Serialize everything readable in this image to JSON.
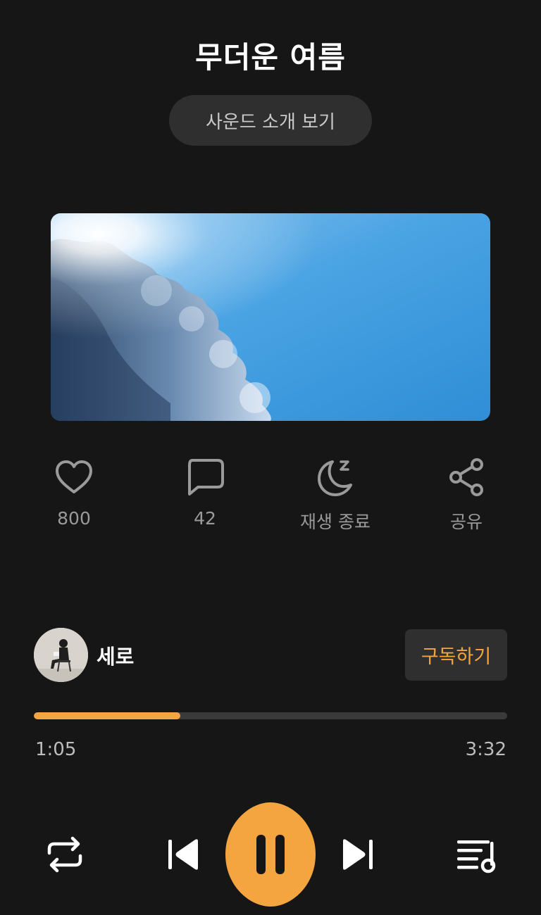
{
  "header": {
    "title": "무더운 여름",
    "intro_label": "사운드 소개 보기"
  },
  "actions": {
    "like_count": "800",
    "comment_count": "42",
    "sleep_timer_label": "재생 종료",
    "share_label": "공유"
  },
  "artist": {
    "name": "세로",
    "subscribe_label": "구독하기"
  },
  "player": {
    "current_time": "1:05",
    "total_time": "3:32",
    "progress": 0.309
  },
  "colors": {
    "accent": "#f5a540",
    "background": "#161616",
    "surface": "#2f2f2f"
  },
  "icons": {
    "like": "heart-icon",
    "comment": "speech-bubble-icon",
    "sleep": "moon-zzz-icon",
    "share": "share-icon",
    "repeat": "repeat-icon",
    "previous": "skip-previous-icon",
    "pause": "pause-icon",
    "next": "skip-next-icon",
    "playlist": "playlist-icon"
  }
}
